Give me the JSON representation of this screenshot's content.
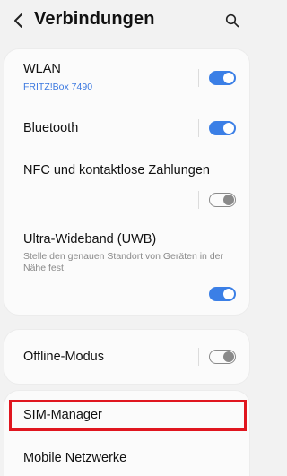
{
  "header": {
    "title": "Verbindungen",
    "back_icon": "chevron-left-icon",
    "search_icon": "search-icon"
  },
  "settings": {
    "wlan": {
      "label": "WLAN",
      "sublabel": "FRITZ!Box 7490",
      "toggle": "on"
    },
    "bluetooth": {
      "label": "Bluetooth",
      "toggle": "on"
    },
    "nfc": {
      "label": "NFC und kontaktlose Zahlungen",
      "toggle": "off"
    },
    "uwb": {
      "label": "Ultra-Wideband (UWB)",
      "description": "Stelle den genauen Standort von Geräten in der Nähe fest.",
      "toggle": "on"
    },
    "offline": {
      "label": "Offline-Modus",
      "toggle": "off"
    },
    "sim_manager": {
      "label": "SIM-Manager"
    },
    "mobile_networks": {
      "label": "Mobile Netzwerke"
    }
  },
  "colors": {
    "accent": "#3b7fe6",
    "link": "#3b78e0",
    "highlight": "#e0161f",
    "background": "#f2f2f2"
  }
}
